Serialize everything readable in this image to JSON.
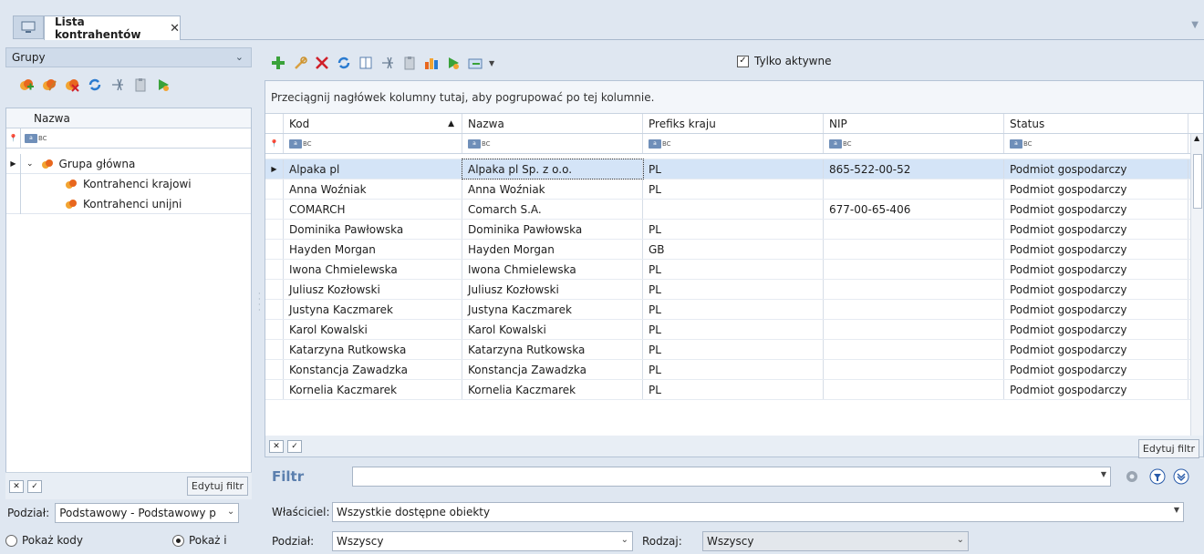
{
  "tabs": {
    "active_label": "Lista kontrahentów",
    "close": "✕"
  },
  "left": {
    "header": "Grupy",
    "column": "Nazwa",
    "tree": [
      {
        "label": "Grupa główna",
        "level": 0
      },
      {
        "label": "Kontrahenci krajowi",
        "level": 1
      },
      {
        "label": "Kontrahenci unijni",
        "level": 1
      }
    ],
    "edit_filter": "Edytuj filtr",
    "podzial_label": "Podział:",
    "podzial_value": "Podstawowy - Podstawowy p",
    "radio1": "Pokaż kody",
    "radio2": "Pokaż i"
  },
  "main": {
    "only_active": "Tylko aktywne",
    "group_hint": "Przeciągnij nagłówek kolumny tutaj, aby pogrupować po tej kolumnie.",
    "columns": [
      "Kod",
      "Nazwa",
      "Prefiks kraju",
      "NIP",
      "Status"
    ],
    "rows": [
      {
        "kod": "Alpaka pl",
        "nazwa": "Alpaka pl Sp. z o.o.",
        "prefiks": "PL",
        "nip": "865-522-00-52",
        "status": "Podmiot gospodarczy"
      },
      {
        "kod": "Anna Woźniak",
        "nazwa": "Anna Woźniak",
        "prefiks": "PL",
        "nip": "",
        "status": "Podmiot gospodarczy"
      },
      {
        "kod": "COMARCH",
        "nazwa": "Comarch S.A.",
        "prefiks": "",
        "nip": "677-00-65-406",
        "status": "Podmiot gospodarczy"
      },
      {
        "kod": "Dominika Pawłowska",
        "nazwa": "Dominika Pawłowska",
        "prefiks": "PL",
        "nip": "",
        "status": "Podmiot gospodarczy"
      },
      {
        "kod": "Hayden Morgan",
        "nazwa": "Hayden Morgan",
        "prefiks": "GB",
        "nip": "",
        "status": "Podmiot gospodarczy"
      },
      {
        "kod": "Iwona Chmielewska",
        "nazwa": "Iwona Chmielewska",
        "prefiks": "PL",
        "nip": "",
        "status": "Podmiot gospodarczy"
      },
      {
        "kod": "Juliusz Kozłowski",
        "nazwa": "Juliusz Kozłowski",
        "prefiks": "PL",
        "nip": "",
        "status": "Podmiot gospodarczy"
      },
      {
        "kod": "Justyna Kaczmarek",
        "nazwa": "Justyna Kaczmarek",
        "prefiks": "PL",
        "nip": "",
        "status": "Podmiot gospodarczy"
      },
      {
        "kod": "Karol Kowalski",
        "nazwa": "Karol Kowalski",
        "prefiks": "PL",
        "nip": "",
        "status": "Podmiot gospodarczy"
      },
      {
        "kod": "Katarzyna Rutkowska",
        "nazwa": "Katarzyna Rutkowska",
        "prefiks": "PL",
        "nip": "",
        "status": "Podmiot gospodarczy"
      },
      {
        "kod": "Konstancja Zawadzka",
        "nazwa": "Konstancja Zawadzka",
        "prefiks": "PL",
        "nip": "",
        "status": "Podmiot gospodarczy"
      },
      {
        "kod": "Kornelia Kaczmarek",
        "nazwa": "Kornelia Kaczmarek",
        "prefiks": "PL",
        "nip": "",
        "status": "Podmiot gospodarczy"
      }
    ],
    "edit_filter": "Edytuj filtr",
    "filtr_label": "Filtr",
    "owner_label": "Właściciel:",
    "owner_value": "Wszystkie dostępne obiekty",
    "podzial_label": "Podział:",
    "podzial_value": "Wszyscy",
    "rodzaj_label": "Rodzaj:",
    "rodzaj_value": "Wszyscy"
  }
}
